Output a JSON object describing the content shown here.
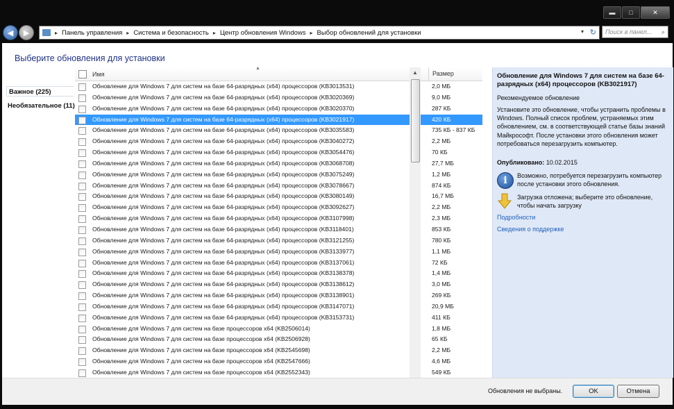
{
  "window": {
    "caption_buttons": {
      "minimize": "▬",
      "maximize": "□",
      "close": "✕"
    }
  },
  "nav": {
    "back_icon": "◀",
    "forward_icon": "▶",
    "breadcrumbs": [
      "Панель управления",
      "Система и безопасность",
      "Центр обновления Windows",
      "Выбор обновлений для установки"
    ],
    "crumb_separator": "▸",
    "dropdown_icon": "▾",
    "refresh_icon": "↻",
    "search_placeholder": "Поиск в панел...",
    "search_icon": "⌕"
  },
  "page": {
    "heading": "Выберите обновления для установки"
  },
  "categories": {
    "important": "Важное (225)",
    "optional": "Необязательное (11)"
  },
  "list": {
    "header_name": "Имя",
    "header_size": "Размер",
    "sort_icon": "▲",
    "selected_index": 3,
    "rows": [
      {
        "name": "Обновление для Windows 7 для систем на базе 64-разрядных (x64) процессоров (KB3013531)",
        "size": "2,0 МБ"
      },
      {
        "name": "Обновление для Windows 7 для систем на базе 64-разрядных (x64) процессоров (KB3020369)",
        "size": "9,0 МБ"
      },
      {
        "name": "Обновление для Windows 7 для систем на базе 64-разрядных (x64) процессоров (KB3020370)",
        "size": "287 КБ"
      },
      {
        "name": "Обновление для Windows 7 для систем на базе 64-разрядных (x64) процессоров (KB3021917)",
        "size": "420 КБ"
      },
      {
        "name": "Обновление для Windows 7 для систем на базе 64-разрядных (x64) процессоров (KB3035583)",
        "size": "735 КБ - 837 КБ"
      },
      {
        "name": "Обновление для Windows 7 для систем на базе 64-разрядных (x64) процессоров (KB3040272)",
        "size": "2,2 МБ"
      },
      {
        "name": "Обновление для Windows 7 для систем на базе 64-разрядных (x64) процессоров (KB3054476)",
        "size": "70 КБ"
      },
      {
        "name": "Обновление для Windows 7 для систем на базе 64-разрядных (x64) процессоров (KB3068708)",
        "size": "27,7 МБ"
      },
      {
        "name": "Обновление для Windows 7 для систем на базе 64-разрядных (x64) процессоров (KB3075249)",
        "size": "1,2 МБ"
      },
      {
        "name": "Обновление для Windows 7 для систем на базе 64-разрядных (x64) процессоров (KB3078667)",
        "size": "874 КБ"
      },
      {
        "name": "Обновление для Windows 7 для систем на базе 64-разрядных (x64) процессоров (KB3080149)",
        "size": "16,7 МБ"
      },
      {
        "name": "Обновление для Windows 7 для систем на базе 64-разрядных (x64) процессоров (KB3092627)",
        "size": "2,2 МБ"
      },
      {
        "name": "Обновление для Windows 7 для систем на базе 64-разрядных (x64) процессоров (KB3107998)",
        "size": "2,3 МБ"
      },
      {
        "name": "Обновление для Windows 7 для систем на базе 64-разрядных (x64) процессоров (KB3118401)",
        "size": "853 КБ"
      },
      {
        "name": "Обновление для Windows 7 для систем на базе 64-разрядных (x64) процессоров (KB3121255)",
        "size": "780 КБ"
      },
      {
        "name": "Обновление для Windows 7 для систем на базе 64-разрядных (x64) процессоров (KB3133977)",
        "size": "1,1 МБ"
      },
      {
        "name": "Обновление для Windows 7 для систем на базе 64-разрядных (x64) процессоров (KB3137061)",
        "size": "72 КБ"
      },
      {
        "name": "Обновление для Windows 7 для систем на базе 64-разрядных (x64) процессоров (KB3138378)",
        "size": "1,4 МБ"
      },
      {
        "name": "Обновление для Windows 7 для систем на базе 64-разрядных (x64) процессоров (KB3138612)",
        "size": "3,0 МБ"
      },
      {
        "name": "Обновление для Windows 7 для систем на базе 64-разрядных (x64) процессоров (KB3138901)",
        "size": "269 КБ"
      },
      {
        "name": "Обновление для Windows 7 для систем на базе 64-разрядных (x64) процессоров (KB3147071)",
        "size": "20,9 МБ"
      },
      {
        "name": "Обновление для Windows 7 для систем на базе 64-разрядных (x64) процессоров (KB3153731)",
        "size": "411 КБ"
      },
      {
        "name": "Обновление для Windows 7 для систем на базе процессоров x64 (KB2506014)",
        "size": "1,8 МБ"
      },
      {
        "name": "Обновление для Windows 7 для систем на базе процессоров x64 (KB2506928)",
        "size": "65 КБ"
      },
      {
        "name": "Обновление для Windows 7 для систем на базе процессоров x64 (KB2545698)",
        "size": "2,2 МБ"
      },
      {
        "name": "Обновление для Windows 7 для систем на базе процессоров x64 (KB2547666)",
        "size": "4,6 МБ"
      },
      {
        "name": "Обновление для Windows 7 для систем на базе процессоров x64 (KB2552343)",
        "size": "549 КБ"
      }
    ]
  },
  "detail": {
    "title": "Обновление для Windows 7 для систем на базе 64-разрядных (x64) процессоров (KB3021917)",
    "recommended": "Рекомендуемое обновление",
    "description": "Установите это обновление, чтобы устранить проблемы в Windows. Полный список проблем, устраняемых этим обновлением, см. в соответствующей статье базы знаний Майкрософт. После установки этого обновления может потребоваться перезагрузить компьютер.",
    "published_label": "Опубликовано:",
    "published_date": "10.02.2015",
    "info_icon": "i",
    "restart_note": "Возможно, потребуется перезагрузить компьютер после установки этого обновления.",
    "deferred_note": "Загрузка отложена; выберите это обновление, чтобы начать загрузку",
    "link_details": "Подробности",
    "link_support": "Сведения о поддержке"
  },
  "footer": {
    "status": "Обновления не выбраны.",
    "ok": "OK",
    "cancel": "Отмена"
  },
  "colors": {
    "selection": "#3399ff",
    "heading": "#1e3287",
    "link": "#1f5fbd",
    "detail_bg": "#dfe8f6"
  }
}
